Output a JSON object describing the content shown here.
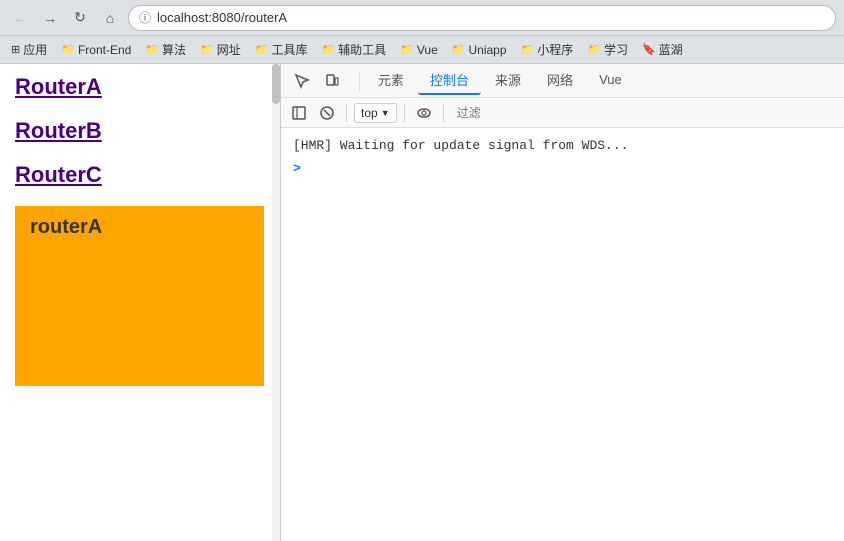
{
  "browser": {
    "url": "localhost:8080/routerA",
    "back_disabled": true,
    "forward_disabled": false,
    "reload_label": "↻"
  },
  "bookmarks": [
    {
      "icon": "⊞",
      "label": "应用"
    },
    {
      "icon": "📁",
      "label": "Front-End"
    },
    {
      "icon": "📁",
      "label": "算法"
    },
    {
      "icon": "📁",
      "label": "网址"
    },
    {
      "icon": "📁",
      "label": "工具库"
    },
    {
      "icon": "📁",
      "label": "辅助工具"
    },
    {
      "icon": "📁",
      "label": "Vue"
    },
    {
      "icon": "📁",
      "label": "Uniapp"
    },
    {
      "icon": "📁",
      "label": "小程序"
    },
    {
      "icon": "📁",
      "label": "学习"
    },
    {
      "icon": "🔖",
      "label": "蓝湖"
    }
  ],
  "left_panel": {
    "links": [
      {
        "label": "RouterA",
        "href": "#"
      },
      {
        "label": "RouterB",
        "href": "#"
      },
      {
        "label": "RouterC",
        "href": "#"
      }
    ],
    "current_route": "routerA"
  },
  "devtools": {
    "tabs": [
      {
        "label": "元素",
        "active": false
      },
      {
        "label": "控制台",
        "active": true
      },
      {
        "label": "来源",
        "active": false
      },
      {
        "label": "网络",
        "active": false
      },
      {
        "label": "Vue",
        "active": false
      }
    ],
    "toolbar": {
      "top_value": "top",
      "filter_placeholder": "过滤"
    },
    "console": {
      "lines": [
        "[HMR] Waiting for update signal from WDS..."
      ],
      "prompt": ">"
    }
  }
}
